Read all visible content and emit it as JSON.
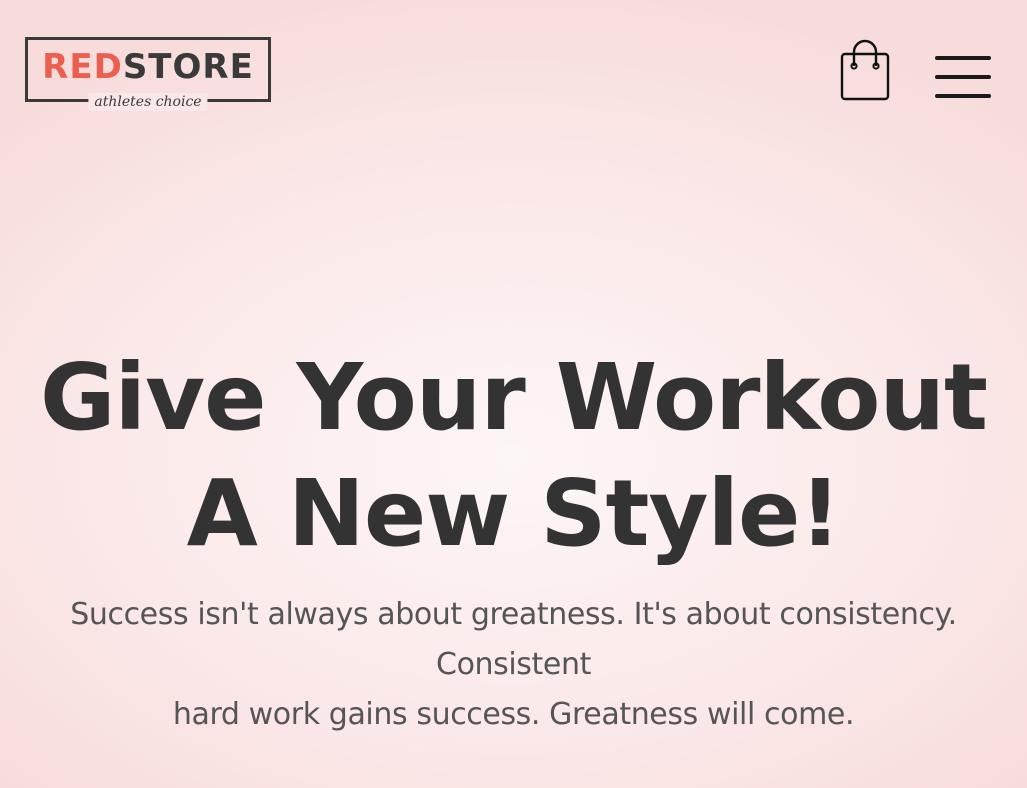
{
  "brand": {
    "logo_red": "RED",
    "logo_dark": "STORE",
    "tagline": "athletes choice",
    "accent_color": "#ee5e4e",
    "text_color": "#3a3a3a"
  },
  "header": {
    "cart_icon": "shopping-bag-icon",
    "menu_icon": "hamburger-menu-icon"
  },
  "hero": {
    "title_line1": "Give Your Workout",
    "title_line2": "A New Style!",
    "text_line1": "Success isn't always about greatness. It's about consistency.",
    "text_line2": "Consistent",
    "text_line3": "hard work gains success. Greatness will come."
  }
}
